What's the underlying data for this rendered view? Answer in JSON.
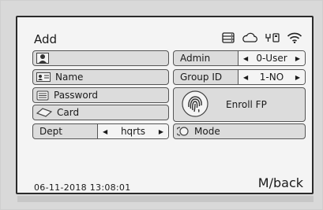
{
  "screen": {
    "title": "Add"
  },
  "status_icons": [
    "storage-icon",
    "cloud-icon",
    "usb-icon",
    "wifi-icon"
  ],
  "left_fields": [
    {
      "label": "",
      "icon": "user-icon"
    },
    {
      "label": "Name",
      "icon": "id-card-icon"
    },
    {
      "label": "Password",
      "icon": "keypad-icon"
    },
    {
      "label": "Card",
      "icon": "card-icon"
    }
  ],
  "dept": {
    "label": "Dept",
    "value": "hqrts"
  },
  "admin": {
    "label": "Admin",
    "value": "0-User"
  },
  "group": {
    "label": "Group ID",
    "value": "1-NO"
  },
  "enroll_fp": {
    "label": "Enroll FP",
    "icon": "fingerprint-icon"
  },
  "mode": {
    "label": "Mode",
    "icon": "mode-icon"
  },
  "footer": {
    "datetime": "06-11-2018  13:08:01",
    "back": "M/back"
  },
  "arrows": {
    "left": "◀",
    "right": "▶"
  }
}
